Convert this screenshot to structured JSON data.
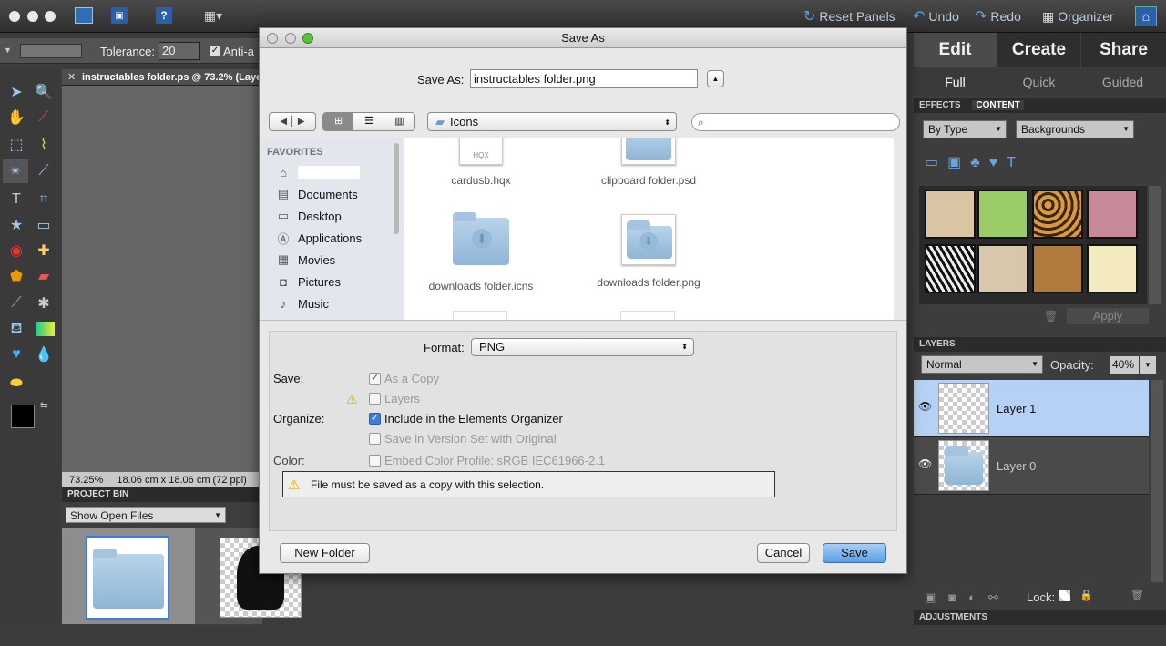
{
  "topbar": {
    "reset_panels": "Reset Panels",
    "undo": "Undo",
    "redo": "Redo",
    "organizer": "Organizer"
  },
  "options": {
    "tolerance_label": "Tolerance:",
    "tolerance_value": "20",
    "anti_alias": "Anti-a"
  },
  "document": {
    "tab_title": "instructables folder.ps @ 73.2% (Laye",
    "zoom": "73.25%",
    "dimensions": "18.06 cm x 18.06 cm (72 ppi)"
  },
  "project_bin": {
    "header": "PROJECT BIN",
    "selector": "Show Open Files"
  },
  "right_panel": {
    "tabs": [
      "Edit",
      "Create",
      "Share"
    ],
    "subtabs": [
      "Full",
      "Quick",
      "Guided"
    ],
    "effects_tab": "EFFECTS",
    "content_tab": "CONTENT",
    "by_type": "By Type",
    "category": "Backgrounds",
    "apply": "Apply",
    "layers_header": "LAYERS",
    "blend_mode": "Normal",
    "opacity_label": "Opacity:",
    "opacity_value": "40%",
    "layers": [
      "Layer 1",
      "Layer 0"
    ],
    "lock_label": "Lock:",
    "adjustments_header": "ADJUSTMENTS"
  },
  "dialog": {
    "title": "Save As",
    "save_as_label": "Save As:",
    "filename": "instructables folder.png",
    "location": "Icons",
    "favorites_header": "FAVORITES",
    "favorites": [
      "Documents",
      "Desktop",
      "Applications",
      "Movies",
      "Pictures",
      "Music"
    ],
    "files": [
      "cardusb.hqx",
      "clipboard folder.psd",
      "downloads folder.icns",
      "downloads folder.png"
    ],
    "hqx_tag": "HQX",
    "format_label": "Format:",
    "format_value": "PNG",
    "save_label": "Save:",
    "as_a_copy": "As a Copy",
    "layers": "Layers",
    "organize_label": "Organize:",
    "include_organizer": "Include in the Elements Organizer",
    "version_set": "Save in Version Set with Original",
    "color_label": "Color:",
    "embed_profile": "Embed Color Profile:  sRGB IEC61966-2.1",
    "warning": "File must be saved as a copy with this selection.",
    "new_folder": "New Folder",
    "cancel": "Cancel",
    "save": "Save"
  },
  "colors": {
    "accent_blue": "#4a8fd8",
    "layer_selected": "#b5d1f5",
    "save_button": "#3d88e0"
  }
}
